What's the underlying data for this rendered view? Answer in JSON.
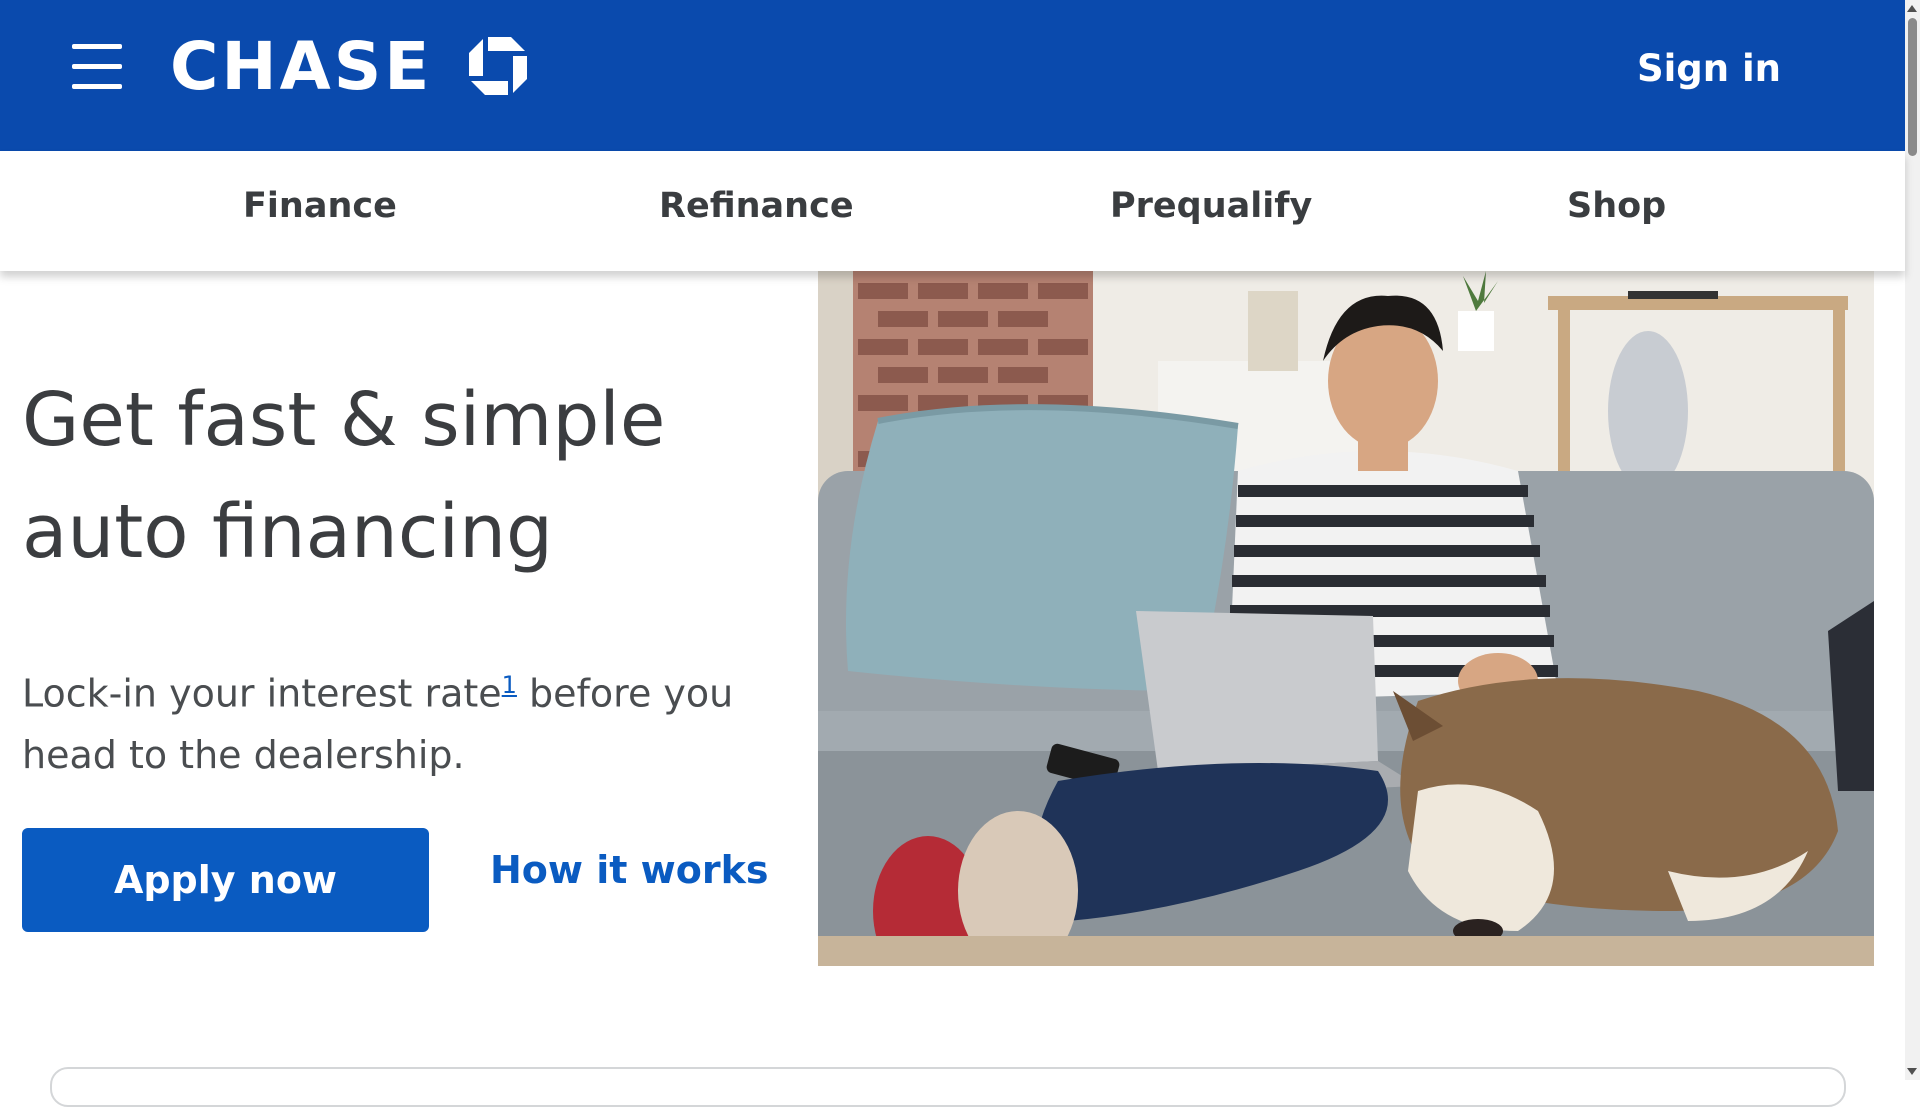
{
  "header": {
    "brand": "CHASE",
    "signin_label": "Sign in",
    "background_color": "#0a4aad"
  },
  "subnav": {
    "items": [
      {
        "label": "Finance"
      },
      {
        "label": "Refinance"
      },
      {
        "label": "Prequalify"
      },
      {
        "label": "Shop"
      }
    ]
  },
  "hero": {
    "title_line1": "Get fast & simple",
    "title_line2": "auto financing",
    "subtitle_part1": "Lock-in your interest rate",
    "footnote_marker": "1",
    "subtitle_part2": " before you head to the dealership.",
    "apply_label": "Apply now",
    "how_label": "How it works",
    "accent_color": "#0a5bc1"
  },
  "icons": {
    "menu": "hamburger-icon",
    "logo": "chase-octagon-logo"
  }
}
